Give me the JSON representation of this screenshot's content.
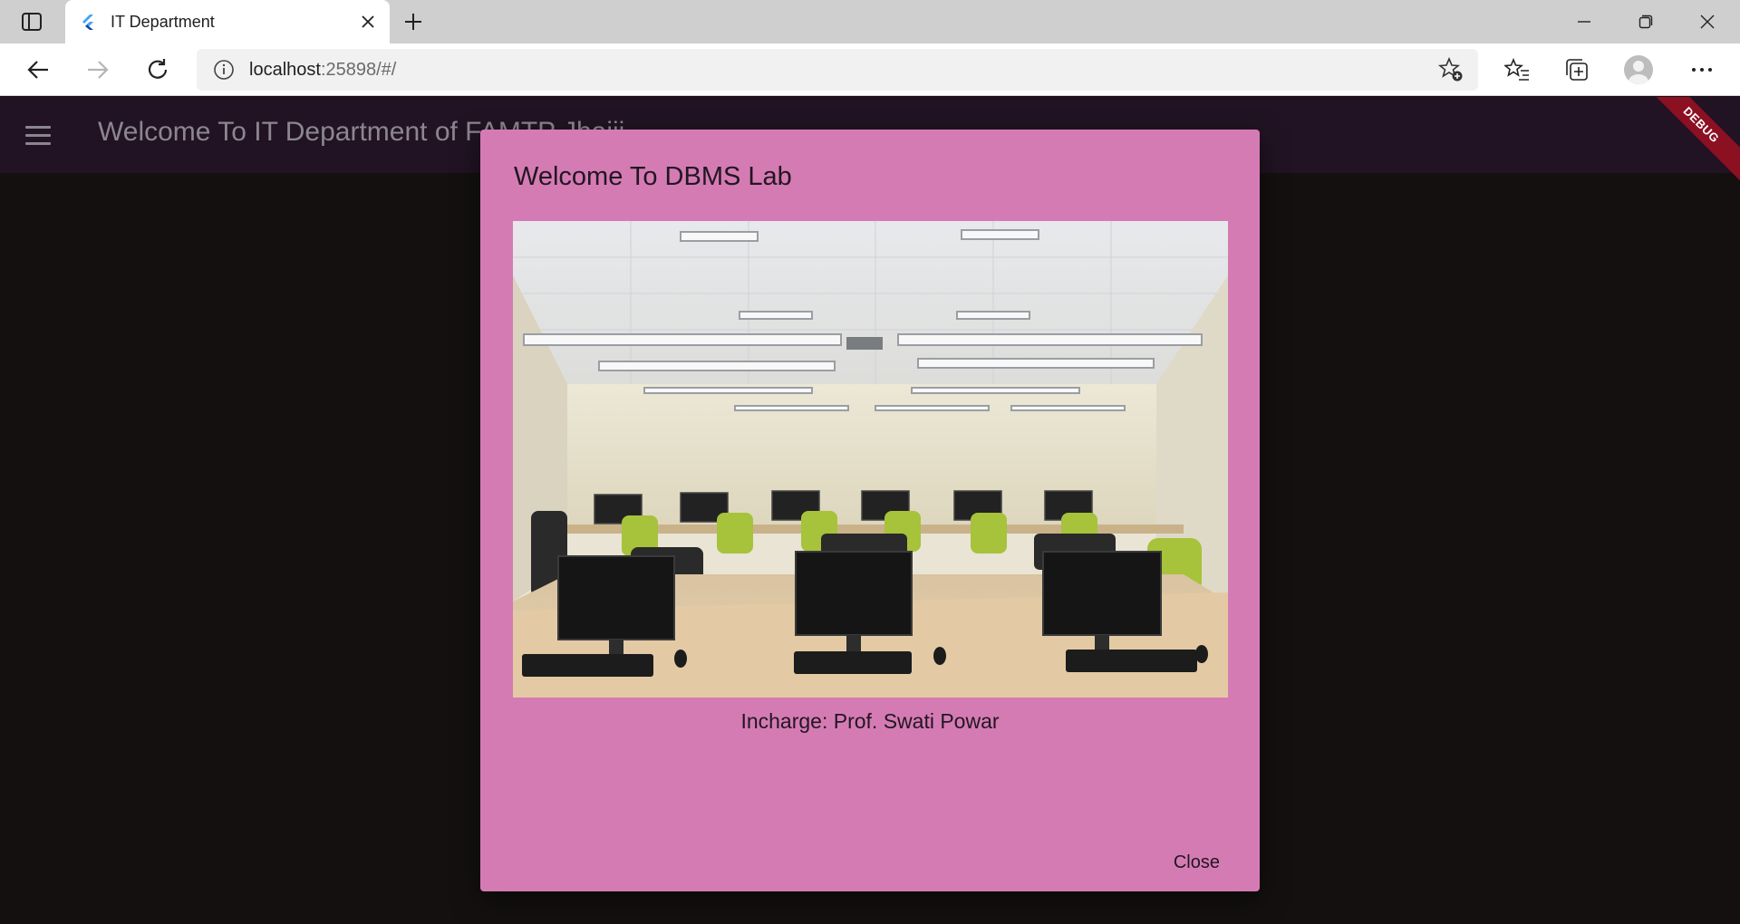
{
  "browser": {
    "tab_title": "IT Department",
    "url_host": "localhost",
    "url_rest": ":25898/#/"
  },
  "app": {
    "title": "Welcome To IT Department of FAMTP Jhajji",
    "debug_label": "DEBUG"
  },
  "dialog": {
    "title": "Welcome To DBMS Lab",
    "image_subject": "computer lab room with rows of desktop computers and green chairs",
    "incharge": "Incharge: Prof. Swati Powar",
    "close_label": "Close"
  },
  "colors": {
    "dialog_bg": "#d57bb4",
    "appbar_bg": "#211323",
    "page_bg": "#141010",
    "debug_banner": "#8b1022"
  },
  "icons": [
    "tab-actions-icon",
    "flutter-favicon-icon",
    "close-icon",
    "plus-icon",
    "minimize-icon",
    "restore-icon",
    "back-icon",
    "forward-icon",
    "refresh-icon",
    "info-icon",
    "add-favorite-icon",
    "favorites-icon",
    "collections-icon",
    "profile-icon",
    "more-icon",
    "hamburger-menu-icon"
  ]
}
